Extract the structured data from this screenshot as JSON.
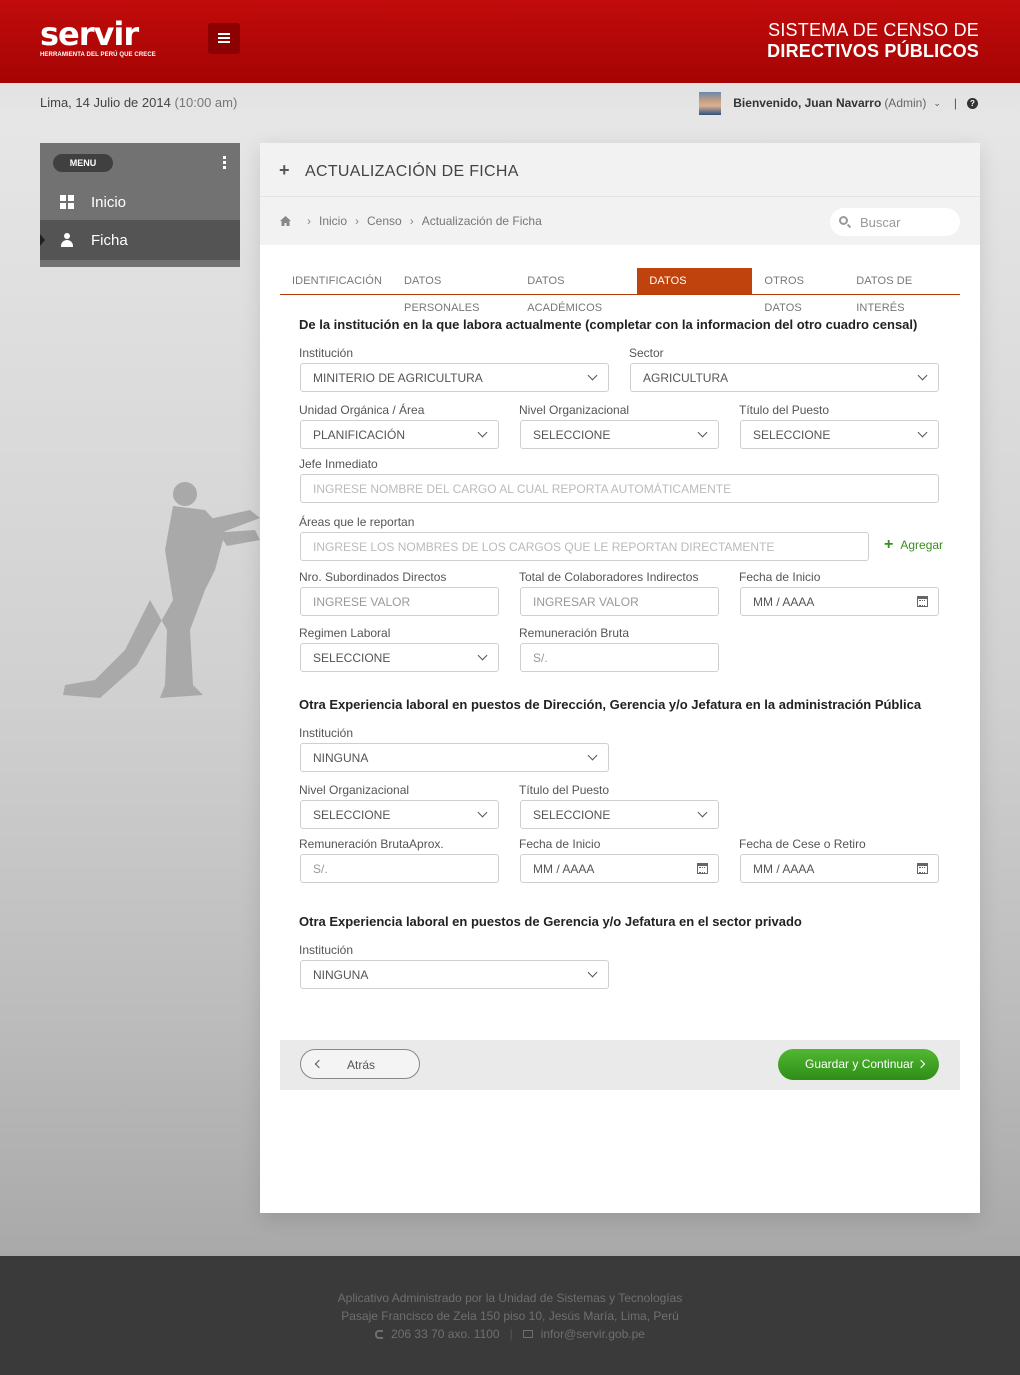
{
  "brand": {
    "logo_text": "servir",
    "tagline": "HERRAMIENTA DEL PERÚ QUE CRECE"
  },
  "app_title": {
    "line1": "SISTEMA DE CENSO  DE",
    "line2": "DIRECTIVOS PÚBLICOS"
  },
  "info": {
    "date": "Lima, 14 Julio de 2014",
    "time": "(10:00 am)"
  },
  "user": {
    "welcome": "Bienvenido, Juan Navarro",
    "role": "(Admin)"
  },
  "sidebar": {
    "menu_label": "MENU",
    "items": [
      {
        "label": "Inicio",
        "icon": "windows-icon"
      },
      {
        "label": "Ficha",
        "icon": "user-icon"
      }
    ]
  },
  "panel": {
    "title": "ACTUALIZACIÓN DE FICHA",
    "breadcrumb": [
      "Inicio",
      "Censo",
      "Actualización de Ficha"
    ],
    "search_placeholder": "Buscar"
  },
  "tabs": [
    "IDENTIFICACIÓN",
    "DATOS PERSONALES",
    "DATOS ACADÉMICOS",
    "DATOS LABORALES",
    "OTROS DATOS",
    "DATOS DE INTERÉS"
  ],
  "active_tab": "DATOS LABORALES",
  "sec1": {
    "title": "De la institución en la que labora actualmente (completar con la informacion del otro cuadro censal)",
    "institucion_label": "Institución",
    "institucion_value": "MINITERIO DE AGRICULTURA",
    "sector_label": "Sector",
    "sector_value": "AGRICULTURA",
    "unidad_label": "Unidad Orgánica / Área",
    "unidad_value": "PLANIFICACIÓN",
    "nivel_label": "Nivel Organizacional",
    "nivel_value": "SELECCIONE",
    "titulo_label": "Título del Puesto",
    "titulo_value": "SELECCIONE",
    "jefe_label": "Jefe Inmediato",
    "jefe_placeholder": "INGRESE NOMBRE DEL CARGO AL CUAL REPORTA AUTOMÁTICAMENTE",
    "areas_label": "Áreas que le reportan",
    "areas_placeholder": "INGRESE LOS NOMBRES DE LOS CARGOS QUE LE REPORTAN DIRECTAMENTE",
    "agregar": "Agregar",
    "subord_label": "Nro. Subordinados Directos",
    "subord_placeholder": "INGRESE VALOR",
    "colab_label": "Total de Colaboradores Indirectos",
    "colab_placeholder": "INGRESAR VALOR",
    "fecha_label": "Fecha de Inicio",
    "fecha_placeholder": "MM / AAAA",
    "regimen_label": "Regimen Laboral",
    "regimen_value": "SELECCIONE",
    "remun_label": "Remuneración Bruta",
    "remun_placeholder": "S/."
  },
  "sec2": {
    "title": "Otra Experiencia laboral en puestos de Dirección, Gerencia y/o Jefatura en la administración Pública",
    "institucion_label": "Institución",
    "institucion_value": "NINGUNA",
    "nivel_label": "Nivel Organizacional",
    "nivel_value": "SELECCIONE",
    "titulo_label": "Título del Puesto",
    "titulo_value": "SELECCIONE",
    "remun_label": "Remuneración BrutaAprox.",
    "remun_placeholder": "S/.",
    "inicio_label": "Fecha de Inicio",
    "inicio_placeholder": "MM / AAAA",
    "cese_label": "Fecha de Cese o Retiro",
    "cese_placeholder": "MM / AAAA"
  },
  "sec3": {
    "title": "Otra Experiencia laboral en puestos de Gerencia y/o Jefatura en el sector privado",
    "institucion_label": "Institución",
    "institucion_value": "NINGUNA"
  },
  "actions": {
    "back": "Atrás",
    "save": "Guardar y Continuar"
  },
  "footer": {
    "line1": "Aplicativo Administrado por la Unidad de Sistemas y Tecnologías",
    "line2": "Pasaje Francisco de Zela 150 piso 10, Jesús María, Lima, Perú",
    "phone": "206 33 70 axo. 1100",
    "email": "infor@servir.gob.pe"
  },
  "colors": {
    "brand_red": "#b30606",
    "tab_active": "#c0420d",
    "primary_green": "#3a9a20"
  }
}
